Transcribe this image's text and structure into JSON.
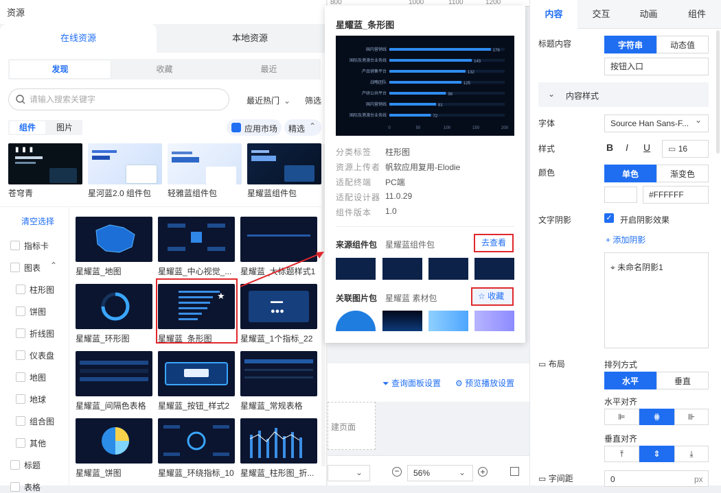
{
  "left": {
    "title": "资源",
    "source_tabs": [
      "在线资源",
      "本地资源"
    ],
    "sub_tabs": [
      "发现",
      "收藏",
      "最近"
    ],
    "search_placeholder": "请输入搜索关键字",
    "sort_label": "最近热门",
    "filter_label": "筛选",
    "kind_tabs": [
      "组件",
      "图片"
    ],
    "market_label": "应用市场",
    "featured_label": "精选",
    "packages": [
      "苍穹青",
      "星河蓝2.0 组件包",
      "轻雅蓝组件包",
      "星耀蓝组件包"
    ],
    "clear_label": "清空选择",
    "filters": [
      "指标卡",
      "图表",
      "柱形图",
      "饼图",
      "折线图",
      "仪表盘",
      "地图",
      "地球",
      "组合图",
      "其他",
      "标题",
      "表格"
    ],
    "cards": [
      "星耀蓝_地图",
      "星耀蓝_中心视觉_...",
      "星耀蓝_大标题样式1",
      "星耀蓝_环形图",
      "星耀蓝_条形图",
      "星耀蓝_1个指标_22",
      "星耀蓝_间隔色表格",
      "星耀蓝_按钮_样式2",
      "星耀蓝_常规表格",
      "星耀蓝_饼图",
      "星耀蓝_环绕指标_10",
      "星耀蓝_柱形图_折..."
    ]
  },
  "ruler": [
    "800",
    "1000",
    "1100",
    "1200"
  ],
  "popup": {
    "title": "星耀蓝_条形图",
    "chart": {
      "categories": [
        "国内营销线",
        "国际及港澳台业务线",
        "产品销售平台",
        "战略团队",
        "产研公共平台",
        "国内营销线",
        "国际及港澳台业务线"
      ],
      "values": [
        176,
        143,
        132,
        125,
        98,
        81,
        72
      ],
      "ticks": [
        "0",
        "50",
        "100",
        "150",
        "200"
      ],
      "xmax": 200
    },
    "meta": [
      {
        "label": "分类标签",
        "value": "柱形图"
      },
      {
        "label": "资源上传者",
        "value": "帆软应用复用-Elodie"
      },
      {
        "label": "适配终端",
        "value": "PC端"
      },
      {
        "label": "适配设计器",
        "value": "11.0.29"
      },
      {
        "label": "组件版本",
        "value": "1.0"
      }
    ],
    "source_pkg_label": "来源组件包",
    "source_pkg_value": "星耀蓝组件包",
    "view_label": "去查看",
    "related_label": "关联图片包",
    "related_value": "星耀蓝 素材包",
    "collect_label": "收藏"
  },
  "middle": {
    "query_panel": "查询面板设置",
    "preview_settings": "预览播放设置",
    "create_page": "建页面",
    "zoom": "56%"
  },
  "right": {
    "tabs": [
      "内容",
      "交互",
      "动画",
      "组件"
    ],
    "title_content_label": "标题内容",
    "title_mode": [
      "字符串",
      "动态值"
    ],
    "title_value": "按钮入口",
    "content_style": "内容样式",
    "font_label": "字体",
    "font_value": "Source Han Sans-F...",
    "style_label": "样式",
    "font_size": "16",
    "color_label": "颜色",
    "color_modes": [
      "单色",
      "渐变色"
    ],
    "color_hex": "#FFFFFF",
    "shadow_label": "文字阴影",
    "shadow_toggle": "开启阴影效果",
    "add_shadow": "添加阴影",
    "shadow_item": "未命名阴影1",
    "layout_label": "布局",
    "arrange_label": "排列方式",
    "arrange_modes": [
      "水平",
      "垂直"
    ],
    "h_align_label": "水平对齐",
    "v_align_label": "垂直对齐",
    "spacing_label": "字间距",
    "spacing_value": "0",
    "spacing_unit": "px"
  }
}
